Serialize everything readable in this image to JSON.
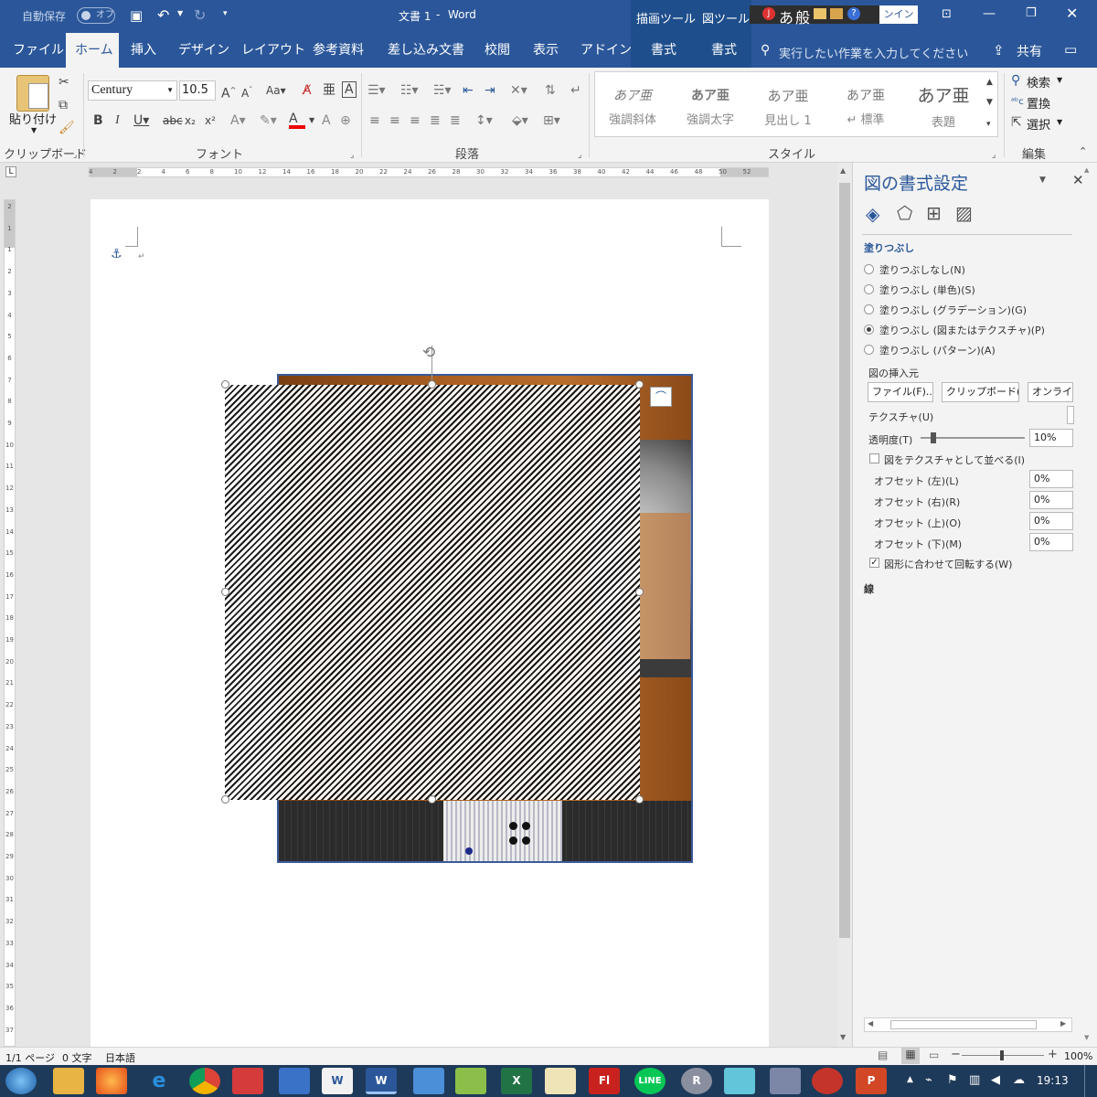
{
  "titlebar": {
    "autosave_label": "自動保存",
    "autosave_state": "オフ",
    "doc_title": "文書 1",
    "title_sep": "-",
    "app_name": "Word",
    "context_tab_1": "描画ツール",
    "context_tab_2": "図ツール",
    "ime_mode": "あ",
    "ime_type": "般",
    "signin_label": "ンイン"
  },
  "tabs": [
    "ファイル",
    "ホーム",
    "挿入",
    "デザイン",
    "レイアウト",
    "参考資料",
    "差し込み文書",
    "校閲",
    "表示",
    "アドイン",
    "書式",
    "書式"
  ],
  "tell_me": "実行したい作業を入力してください",
  "share_label": "共有",
  "ribbon": {
    "paste_label": "貼り付け",
    "clipboard_group": "クリップボード",
    "font_name": "Century",
    "font_size": "10.5",
    "font_group": "フォント",
    "paragraph_group": "段落",
    "styles_group": "スタイル",
    "editing_group": "編集",
    "styles": [
      {
        "preview": "あア亜",
        "name": "強調斜体"
      },
      {
        "preview": "あア亜",
        "name": "強調太字"
      },
      {
        "preview": "あア亜",
        "name": "見出し 1"
      },
      {
        "preview": "あア亜",
        "name": "↵ 標準"
      },
      {
        "preview": "あア亜",
        "name": "表題"
      }
    ],
    "find_label": "検索",
    "replace_label": "置換",
    "select_label": "選択"
  },
  "ruler_numbers": [
    "4",
    "2",
    "2",
    "4",
    "6",
    "8",
    "10",
    "12",
    "14",
    "16",
    "18",
    "20",
    "22",
    "24",
    "26",
    "28",
    "30",
    "32",
    "34",
    "36",
    "38",
    "40",
    "42",
    "44",
    "46",
    "48",
    "50",
    "52"
  ],
  "vruler_numbers": [
    "2",
    "1",
    "1",
    "2",
    "3",
    "4",
    "5",
    "6",
    "7",
    "8",
    "9",
    "10",
    "11",
    "12",
    "13",
    "14",
    "15",
    "16",
    "17",
    "18",
    "19",
    "20",
    "21",
    "22",
    "23",
    "24",
    "25",
    "26",
    "27",
    "28",
    "29",
    "30",
    "31",
    "32",
    "33",
    "34",
    "35",
    "36",
    "37"
  ],
  "pane": {
    "title": "図の書式設定",
    "section_fill": "塗りつぶし",
    "fill_options": [
      {
        "label": "塗りつぶしなし(N)",
        "selected": false
      },
      {
        "label": "塗りつぶし (単色)(S)",
        "selected": false
      },
      {
        "label": "塗りつぶし (グラデーション)(G)",
        "selected": false
      },
      {
        "label": "塗りつぶし (図またはテクスチャ)(P)",
        "selected": true
      },
      {
        "label": "塗りつぶし (パターン)(A)",
        "selected": false
      }
    ],
    "insert_from_label": "図の挿入元",
    "btn_file": "ファイル(F)...",
    "btn_clipboard": "クリップボード(C)",
    "btn_online": "オンライン(",
    "texture_label": "テクスチャ(U)",
    "transparency_label": "透明度(T)",
    "transparency_value": "10%",
    "transparency_fraction": 0.1,
    "tile_label": "図をテクスチャとして並べる(I)",
    "tile_checked": false,
    "offsets": [
      {
        "label": "オフセット (左)(L)",
        "value": "0%"
      },
      {
        "label": "オフセット (右)(R)",
        "value": "0%"
      },
      {
        "label": "オフセット (上)(O)",
        "value": "0%"
      },
      {
        "label": "オフセット (下)(M)",
        "value": "0%"
      }
    ],
    "rotate_label": "図形に合わせて回転する(W)",
    "rotate_checked": true,
    "section_line": "線"
  },
  "status": {
    "page": "1/1 ページ",
    "words": "0 文字",
    "language": "日本語",
    "zoom": "100%"
  },
  "taskbar": {
    "time": "19:13"
  },
  "colors": {
    "brand": "#2b579a",
    "taskbar": "#1e3a5a",
    "photo_bg": "#a25d22"
  }
}
